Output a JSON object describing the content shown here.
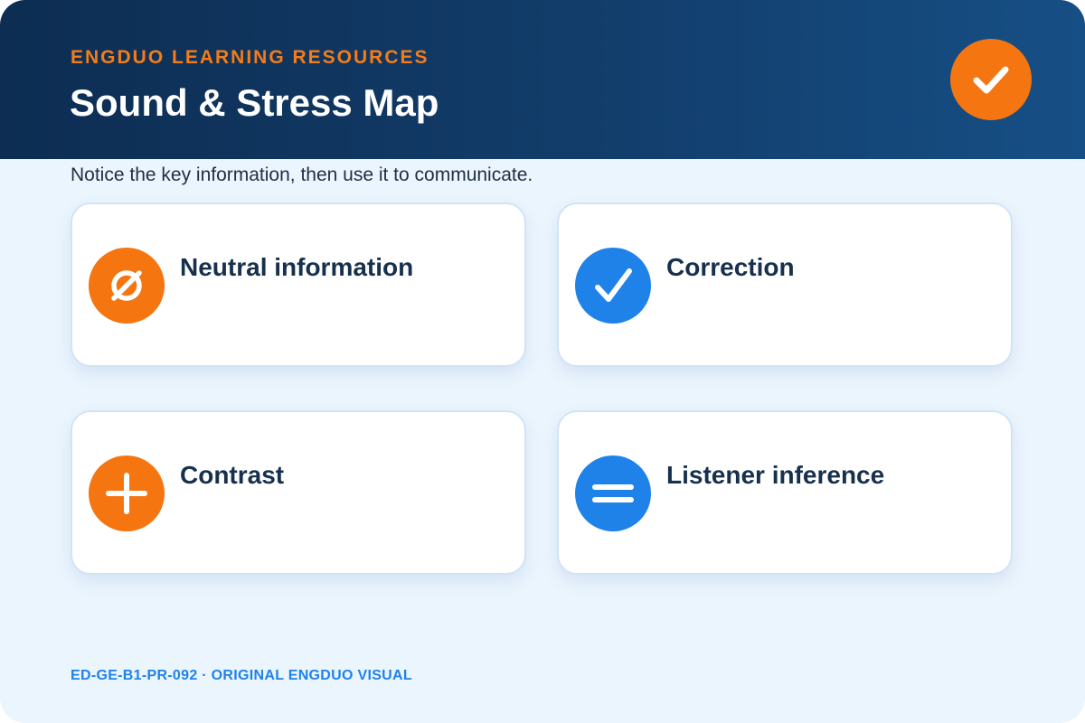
{
  "header": {
    "eyebrow": "ENGDUO LEARNING RESOURCES",
    "title": "Sound & Stress Map",
    "badge_icon": "checkmark-icon"
  },
  "subtitle": "Notice the key information, then use it to communicate.",
  "cards": [
    {
      "label": "Neutral information",
      "icon": "empty-set-icon",
      "color": "#f57511"
    },
    {
      "label": "Correction",
      "icon": "checkmark-icon",
      "color": "#1f82e8"
    },
    {
      "label": "Contrast",
      "icon": "plus-icon",
      "color": "#f57511"
    },
    {
      "label": "Listener inference",
      "icon": "equals-icon",
      "color": "#1f82e8"
    }
  ],
  "footer": "ED-GE-B1-PR-092 · ORIGINAL ENGDUO VISUAL",
  "colors": {
    "header_dark": "#0d2d52",
    "accent_orange": "#f57511",
    "accent_blue": "#1f82e8",
    "background": "#ebf5fe"
  }
}
